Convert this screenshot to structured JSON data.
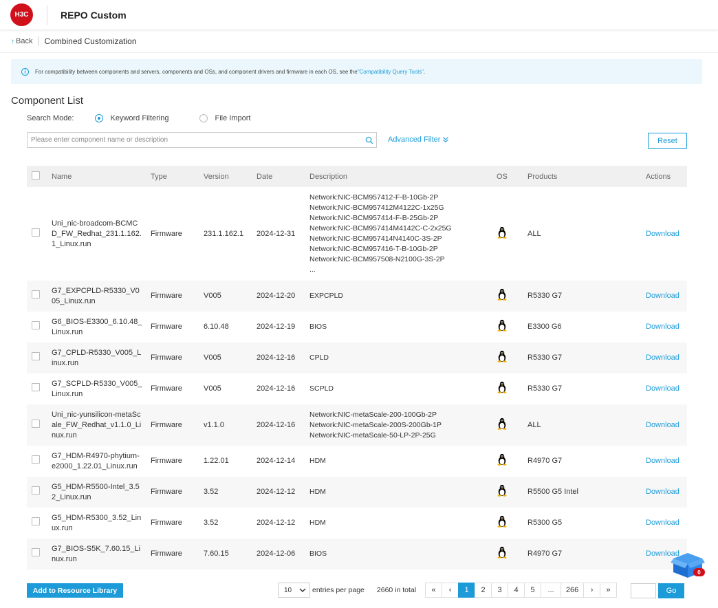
{
  "header": {
    "logo_text": "H3C",
    "title": "REPO Custom"
  },
  "breadcrumb": {
    "back_label": "Back",
    "current": "Combined Customization"
  },
  "notice": {
    "text": "For compatibility between components and servers, components and OSs, and component drivers and firmware in each OS, see the ",
    "link": "\"Compatibility Query Tools\"",
    "suffix": "."
  },
  "section_title": "Component List",
  "search_mode": {
    "label": "Search Mode:",
    "options": [
      "Keyword Filtering",
      "File Import"
    ],
    "selected": "Keyword Filtering"
  },
  "search": {
    "placeholder": "Please enter component name or description",
    "value": ""
  },
  "advanced_filter_label": "Advanced Filter",
  "reset_label": "Reset",
  "table": {
    "headers": {
      "name": "Name",
      "type": "Type",
      "version": "Version",
      "date": "Date",
      "description": "Description",
      "os": "OS",
      "products": "Products",
      "actions": "Actions"
    },
    "rows": [
      {
        "name": "Uni_nic-broadcom-BCMCD_FW_Redhat_231.1.162.1_Linux.run",
        "type": "Firmware",
        "version": "231.1.162.1",
        "date": "2024-12-31",
        "description": [
          "Network:NIC-BCM957412-F-B-10Gb-2P",
          "Network:NIC-BCM957412M4122C-1x25G",
          "Network:NIC-BCM957414-F-B-25Gb-2P",
          "Network:NIC-BCM957414M4142C-C-2x25G",
          "Network:NIC-BCM957414N4140C-3S-2P",
          "Network:NIC-BCM957416-T-B-10Gb-2P",
          "Network:NIC-BCM957508-N2100G-3S-2P",
          "..."
        ],
        "os": "linux-icon",
        "products": "ALL",
        "action": "Download"
      },
      {
        "name": "G7_EXPCPLD-R5330_V005_Linux.run",
        "type": "Firmware",
        "version": "V005",
        "date": "2024-12-20",
        "description": [
          "EXPCPLD"
        ],
        "os": "linux-icon",
        "products": "R5330 G7",
        "action": "Download"
      },
      {
        "name": "G6_BIOS-E3300_6.10.48_Linux.run",
        "type": "Firmware",
        "version": "6.10.48",
        "date": "2024-12-19",
        "description": [
          "BIOS"
        ],
        "os": "linux-icon",
        "products": "E3300 G6",
        "action": "Download"
      },
      {
        "name": "G7_CPLD-R5330_V005_Linux.run",
        "type": "Firmware",
        "version": "V005",
        "date": "2024-12-16",
        "description": [
          "CPLD"
        ],
        "os": "linux-icon",
        "products": "R5330 G7",
        "action": "Download"
      },
      {
        "name": "G7_SCPLD-R5330_V005_Linux.run",
        "type": "Firmware",
        "version": "V005",
        "date": "2024-12-16",
        "description": [
          "SCPLD"
        ],
        "os": "linux-icon",
        "products": "R5330 G7",
        "action": "Download"
      },
      {
        "name": "Uni_nic-yunsilicon-metaScale_FW_Redhat_v1.1.0_Linux.run",
        "type": "Firmware",
        "version": "v1.1.0",
        "date": "2024-12-16",
        "description": [
          "Network:NIC-metaScale-200-100Gb-2P",
          "Network:NIC-metaScale-200S-200Gb-1P",
          "Network:NIC-metaScale-50-LP-2P-25G"
        ],
        "os": "linux-icon",
        "products": "ALL",
        "action": "Download"
      },
      {
        "name": "G7_HDM-R4970-phytium-e2000_1.22.01_Linux.run",
        "type": "Firmware",
        "version": "1.22.01",
        "date": "2024-12-14",
        "description": [
          "HDM"
        ],
        "os": "linux-icon",
        "products": "R4970 G7",
        "action": "Download"
      },
      {
        "name": "G5_HDM-R5500-Intel_3.52_Linux.run",
        "type": "Firmware",
        "version": "3.52",
        "date": "2024-12-12",
        "description": [
          "HDM"
        ],
        "os": "linux-icon",
        "products": "R5500 G5 Intel",
        "action": "Download"
      },
      {
        "name": "G5_HDM-R5300_3.52_Linux.run",
        "type": "Firmware",
        "version": "3.52",
        "date": "2024-12-12",
        "description": [
          "HDM"
        ],
        "os": "linux-icon",
        "products": "R5300 G5",
        "action": "Download"
      },
      {
        "name": "G7_BIOS-S5K_7.60.15_Linux.run",
        "type": "Firmware",
        "version": "7.60.15",
        "date": "2024-12-06",
        "description": [
          "BIOS"
        ],
        "os": "linux-icon",
        "products": "R4970 G7",
        "action": "Download"
      }
    ]
  },
  "add_button_label": "Add to Resource Library",
  "pagination": {
    "per_page": "10",
    "per_page_label": "entries per page",
    "total_label": "2660 in total",
    "first": "«",
    "prev": "‹",
    "pages": [
      "1",
      "2",
      "3",
      "4",
      "5",
      "...",
      "266"
    ],
    "current": "1",
    "next": "›",
    "last": "»",
    "go_label": "Go"
  },
  "cart": {
    "badge_count": "0",
    "icon": "cart-box-icon"
  },
  "colors": {
    "accent": "#1c9bd8",
    "brand": "#d0111b"
  }
}
